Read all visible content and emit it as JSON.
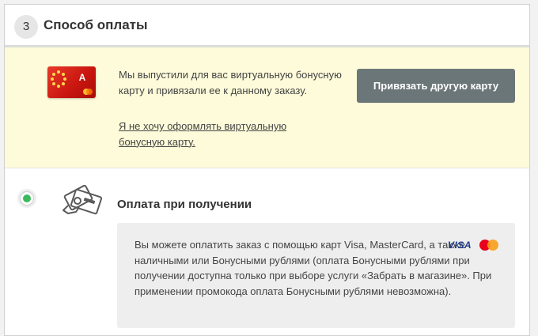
{
  "step": {
    "number": "3",
    "title": "Способ оплаты"
  },
  "promo": {
    "text": "Мы выпустили для вас виртуальную бонусную карту и привязали ее к данному заказу.",
    "link": "Я не хочу оформлять виртуальную бонусную карту.",
    "button": "Привязать другую карту",
    "card_icon": "bonus-card-icon",
    "card_glyph": "А"
  },
  "payment": {
    "selected": true,
    "title": "Оплата при получении",
    "icon": "cash-card-icon",
    "info": "Вы можете оплатить заказ с помощью карт Visa, MasterCard, а также наличными или Бонусными рублями (оплата Бонусными рублями при получении доступна только при выборе услуги «Забрать в магазине». При применении промокода оплата Бонусными рублями невозможна).",
    "visa_label": "VISA",
    "mastercard_label": "MasterCard"
  },
  "colors": {
    "promo_bg": "#fdfbd9",
    "button_bg": "#6b7678",
    "radio_selected": "#3cb95c",
    "card_red": "#d9251b"
  }
}
